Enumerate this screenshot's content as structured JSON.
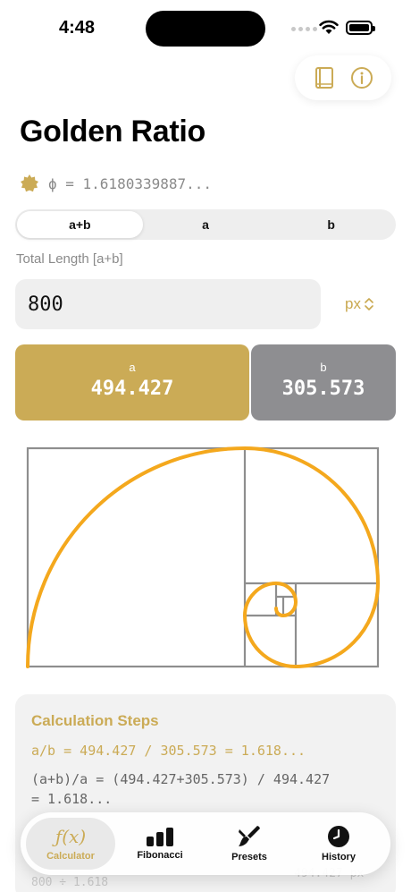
{
  "status": {
    "time": "4:48"
  },
  "page": {
    "title": "Golden Ratio",
    "phi_text": "ϕ = 1.6180339887..."
  },
  "segments": [
    {
      "label": "a+b",
      "active": true
    },
    {
      "label": "a",
      "active": false
    },
    {
      "label": "b",
      "active": false
    }
  ],
  "input": {
    "label": "Total Length [a+b]",
    "value": "800",
    "unit": "px"
  },
  "results": {
    "a": {
      "label": "a",
      "value": "494.427"
    },
    "b": {
      "label": "b",
      "value": "305.573"
    }
  },
  "steps": {
    "title": "Calculation Steps",
    "line1": "a/b = 494.427 / 305.573 = 1.618...",
    "line2a": "(a+b)/a = (494.427+305.573) / 494.427",
    "line2b": "= 1.618...",
    "ghost_left": "800 ÷ 1.618",
    "ghost_right": "494.427 px"
  },
  "tabs": [
    {
      "label": "Calculator",
      "icon": "function-icon",
      "active": true
    },
    {
      "label": "Fibonacci",
      "icon": "bar-chart-icon",
      "active": false
    },
    {
      "label": "Presets",
      "icon": "paintbrush-icon",
      "active": false
    },
    {
      "label": "History",
      "icon": "clock-icon",
      "active": false
    }
  ],
  "colors": {
    "gold": "#cbab56",
    "gray": "#8e8e91",
    "spiral": "#f4a81d"
  }
}
